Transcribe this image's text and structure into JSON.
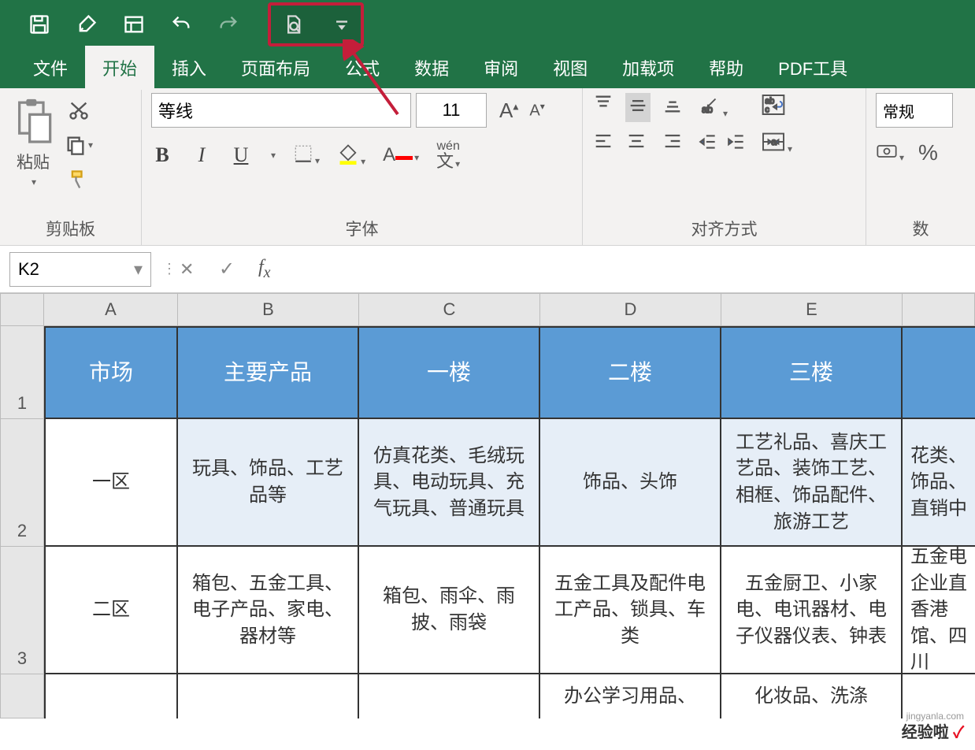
{
  "qat_icons": [
    "save",
    "brush",
    "layout",
    "undo",
    "redo",
    "preview",
    "dropdown"
  ],
  "tabs": [
    "文件",
    "开始",
    "插入",
    "页面布局",
    "公式",
    "数据",
    "审阅",
    "视图",
    "加载项",
    "帮助",
    "PDF工具"
  ],
  "active_tab": "开始",
  "clipboard": {
    "paste": "粘贴",
    "group": "剪贴板"
  },
  "font": {
    "name": "等线",
    "size": "11",
    "group": "字体",
    "bold": "B",
    "italic": "I",
    "underline": "U"
  },
  "align": {
    "group": "对齐方式"
  },
  "number": {
    "format": "常规",
    "percent": "%",
    "group": "数"
  },
  "namebox": "K2",
  "columns": [
    "A",
    "B",
    "C",
    "D",
    "E"
  ],
  "row_numbers": [
    "1",
    "2",
    "3"
  ],
  "header_row": [
    "市场",
    "主要产品",
    "一楼",
    "二楼",
    "三楼"
  ],
  "header_partial": "",
  "rows": [
    {
      "A": "一区",
      "B": "玩具、饰品、工艺品等",
      "C": "仿真花类、毛绒玩具、电动玩具、充气玩具、普通玩具",
      "D": "饰品、头饰",
      "E": "工艺礼品、喜庆工艺品、装饰工艺、相框、饰品配件、旅游工艺",
      "F": "花类、饰品、直销中"
    },
    {
      "A": "二区",
      "B": "箱包、五金工具、电子产品、家电、器材等",
      "C": "箱包、雨伞、雨披、雨袋",
      "D": "五金工具及配件电工产品、锁具、车类",
      "E": "五金厨卫、小家电、电讯器材、电子仪器仪表、钟表",
      "F": "五金电企业直香港馆、四川"
    },
    {
      "A": "",
      "B": "",
      "C": "",
      "D": "办公学习用品、",
      "E": "化妆品、洗涤",
      "F": ""
    }
  ],
  "watermark_brand": "经验啦",
  "watermark_url": "jingyanla.com"
}
